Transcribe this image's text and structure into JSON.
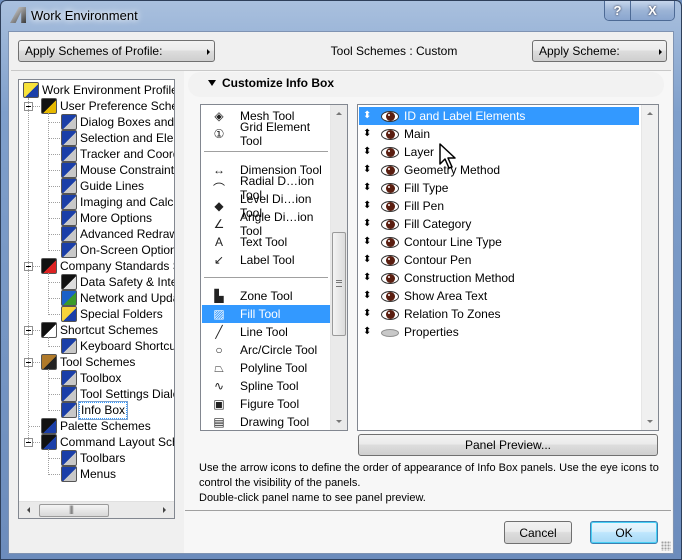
{
  "window": {
    "title": "Work Environment",
    "help_label": "?",
    "close_label": "X"
  },
  "header": {
    "profile_button": "Apply Schemes of Profile:",
    "scheme_status": "Tool Schemes : Custom",
    "scheme_button": "Apply Scheme:"
  },
  "tree": {
    "items": [
      {
        "label": "Work Environment Profiles",
        "icon": "profiles-icon",
        "level": 0
      },
      {
        "label": "User Preference Schemes",
        "icon": "user-scheme-icon",
        "level": 1,
        "expanded": true
      },
      {
        "label": "Dialog Boxes and Palettes",
        "icon": "dialog-boxes-icon",
        "level": 2
      },
      {
        "label": "Selection and Element Information",
        "icon": "selection-icon",
        "level": 2
      },
      {
        "label": "Tracker and Coordinate Input",
        "icon": "tracker-icon",
        "level": 2
      },
      {
        "label": "Mouse Constraints and Cursor Snap",
        "icon": "mouse-icon",
        "level": 2
      },
      {
        "label": "Guide Lines",
        "icon": "guide-lines-icon",
        "level": 2
      },
      {
        "label": "Imaging and Calculation",
        "icon": "imaging-icon",
        "level": 2
      },
      {
        "label": "More Options",
        "icon": "more-options-icon",
        "level": 2
      },
      {
        "label": "Advanced Redraw Options",
        "icon": "advanced-redraw-icon",
        "level": 2
      },
      {
        "label": "On-Screen Options",
        "icon": "on-screen-icon",
        "level": 2
      },
      {
        "label": "Company Standards Schemes",
        "icon": "company-scheme-icon",
        "level": 1,
        "expanded": true
      },
      {
        "label": "Data Safety & Integrity",
        "icon": "data-safety-icon",
        "level": 2
      },
      {
        "label": "Network and Update",
        "icon": "network-icon",
        "level": 2
      },
      {
        "label": "Special Folders",
        "icon": "folder-icon",
        "level": 2
      },
      {
        "label": "Shortcut Schemes",
        "icon": "shortcut-scheme-icon",
        "level": 1,
        "expanded": true
      },
      {
        "label": "Keyboard Shortcuts",
        "icon": "keyboard-shortcut-icon",
        "level": 2
      },
      {
        "label": "Tool Schemes",
        "icon": "tool-scheme-icon",
        "level": 1,
        "expanded": true
      },
      {
        "label": "Toolbox",
        "icon": "toolbox-icon",
        "level": 2
      },
      {
        "label": "Tool Settings Dialogs",
        "icon": "tool-settings-icon",
        "level": 2
      },
      {
        "label": "Info Box",
        "icon": "info-box-icon",
        "level": 2,
        "selected": true
      },
      {
        "label": "Palette Schemes",
        "icon": "palette-scheme-icon",
        "level": 1
      },
      {
        "label": "Command Layout Schemes",
        "icon": "command-layout-icon",
        "level": 1,
        "expanded": true
      },
      {
        "label": "Toolbars",
        "icon": "toolbars-icon",
        "level": 2
      },
      {
        "label": "Menus",
        "icon": "menus-icon",
        "level": 2
      }
    ]
  },
  "customize": {
    "title": "Customize Info Box"
  },
  "tools": {
    "items": [
      {
        "label": "Mesh Tool",
        "icon": "mesh-tool-icon",
        "glyph": "◈"
      },
      {
        "label": "Grid Element Tool",
        "icon": "grid-element-tool-icon",
        "glyph": "①"
      },
      {
        "separator": true
      },
      {
        "label": "Dimension Tool",
        "icon": "dimension-tool-icon",
        "glyph": "↔"
      },
      {
        "label": "Radial D…ion Tool",
        "icon": "radial-dimension-tool-icon",
        "glyph": "⌒"
      },
      {
        "label": "Level Di…ion Tool",
        "icon": "level-dimension-tool-icon",
        "glyph": "◆"
      },
      {
        "label": "Angle Di…ion Tool",
        "icon": "angle-dimension-tool-icon",
        "glyph": "∠"
      },
      {
        "label": "Text Tool",
        "icon": "text-tool-icon",
        "glyph": "A"
      },
      {
        "label": "Label Tool",
        "icon": "label-tool-icon",
        "glyph": "↙"
      },
      {
        "separator": true
      },
      {
        "label": "Zone Tool",
        "icon": "zone-tool-icon",
        "glyph": "▙"
      },
      {
        "label": "Fill Tool",
        "icon": "fill-tool-icon",
        "glyph": "▨",
        "selected": true
      },
      {
        "label": "Line Tool",
        "icon": "line-tool-icon",
        "glyph": "╱"
      },
      {
        "label": "Arc/Circle Tool",
        "icon": "arc-circle-tool-icon",
        "glyph": "○"
      },
      {
        "label": "Polyline Tool",
        "icon": "polyline-tool-icon",
        "glyph": "⏢"
      },
      {
        "label": "Spline Tool",
        "icon": "spline-tool-icon",
        "glyph": "∿"
      },
      {
        "label": "Figure Tool",
        "icon": "figure-tool-icon",
        "glyph": "▣"
      },
      {
        "label": "Drawing Tool",
        "icon": "drawing-tool-icon",
        "glyph": "▤"
      }
    ]
  },
  "panels": {
    "items": [
      {
        "label": "ID and Label Elements",
        "visible": true,
        "selected": true
      },
      {
        "label": "Main",
        "visible": true
      },
      {
        "label": "Layer",
        "visible": true
      },
      {
        "label": "Geometry Method",
        "visible": true
      },
      {
        "label": "Fill Type",
        "visible": true
      },
      {
        "label": "Fill Pen",
        "visible": true
      },
      {
        "label": "Fill Category",
        "visible": true
      },
      {
        "label": "Contour Line Type",
        "visible": true
      },
      {
        "label": "Contour Pen",
        "visible": true
      },
      {
        "label": "Construction Method",
        "visible": true
      },
      {
        "label": "Show Area Text",
        "visible": true
      },
      {
        "label": "Relation To Zones",
        "visible": true
      },
      {
        "label": "Properties",
        "visible": false
      }
    ],
    "reorder_glyph": "⬍"
  },
  "preview_button": "Panel Preview...",
  "hint": {
    "line1": "Use the arrow icons to define the order of appearance of Info Box panels. Use the eye icons to control the visibility of the panels.",
    "line2": "Double-click panel name to see panel preview."
  },
  "footer": {
    "cancel": "Cancel",
    "ok": "OK"
  },
  "colors": {
    "selection": "#3399ff",
    "titlebar": "#7f9fcb",
    "eye_iris": "#5a1e10"
  }
}
